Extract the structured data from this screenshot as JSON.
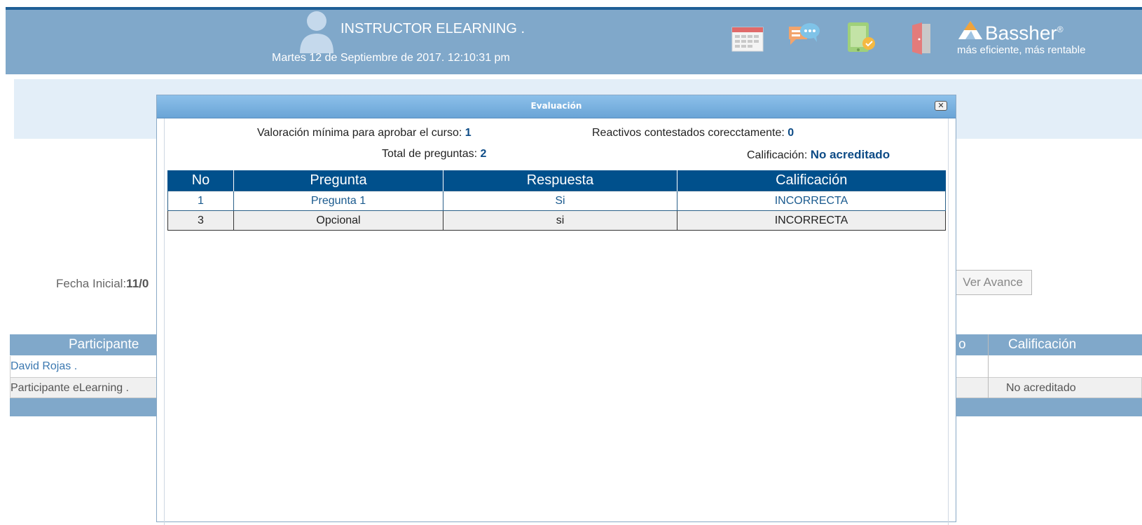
{
  "header": {
    "user_name": "INSTRUCTOR ELEARNING .",
    "datetime": "Martes 12 de Septiembre de 2017. 12:10:31 pm",
    "icons": [
      "calendar-icon",
      "chat-icon",
      "tablet-icon",
      "exit-door-icon"
    ],
    "logo": {
      "brand": "Bassher",
      "registered": "®",
      "tagline": "más eficiente, más rentable"
    },
    "colors": {
      "bar": "#80a8ca",
      "topline": "#1f5f96"
    }
  },
  "page": {
    "fecha_label": "Fecha Inicial:",
    "fecha_value": "11/0",
    "ver_avance_label": "Ver Avance",
    "table": {
      "headers": {
        "participante": "Participante",
        "partial": "o",
        "calificacion": "Calificación"
      },
      "rows": [
        {
          "participante": "David Rojas .",
          "calificacion": ""
        },
        {
          "participante": "Participante eLearning .",
          "calificacion": "No acreditado"
        }
      ]
    }
  },
  "modal": {
    "title": "Evaluación",
    "close_symbol": "✕",
    "stats": {
      "valoracion_label": "Valoración mínima para aprobar el curso:",
      "valoracion_value": "1",
      "total_label": "Total de preguntas:",
      "total_value": "2",
      "reactivos_label": "Reactivos contestados corecctamente:",
      "reactivos_value": "0",
      "calificacion_label": "Calificación:",
      "calificacion_value": "No acreditado"
    },
    "table": {
      "headers": [
        "No",
        "Pregunta",
        "Respuesta",
        "Calificación"
      ],
      "rows": [
        [
          "1",
          "Pregunta 1",
          "Si",
          "INCORRECTA"
        ],
        [
          "3",
          "Opcional",
          "si",
          "INCORRECTA"
        ]
      ]
    },
    "colors": {
      "table_header": "#00508c",
      "value": "#0d4b86"
    }
  }
}
